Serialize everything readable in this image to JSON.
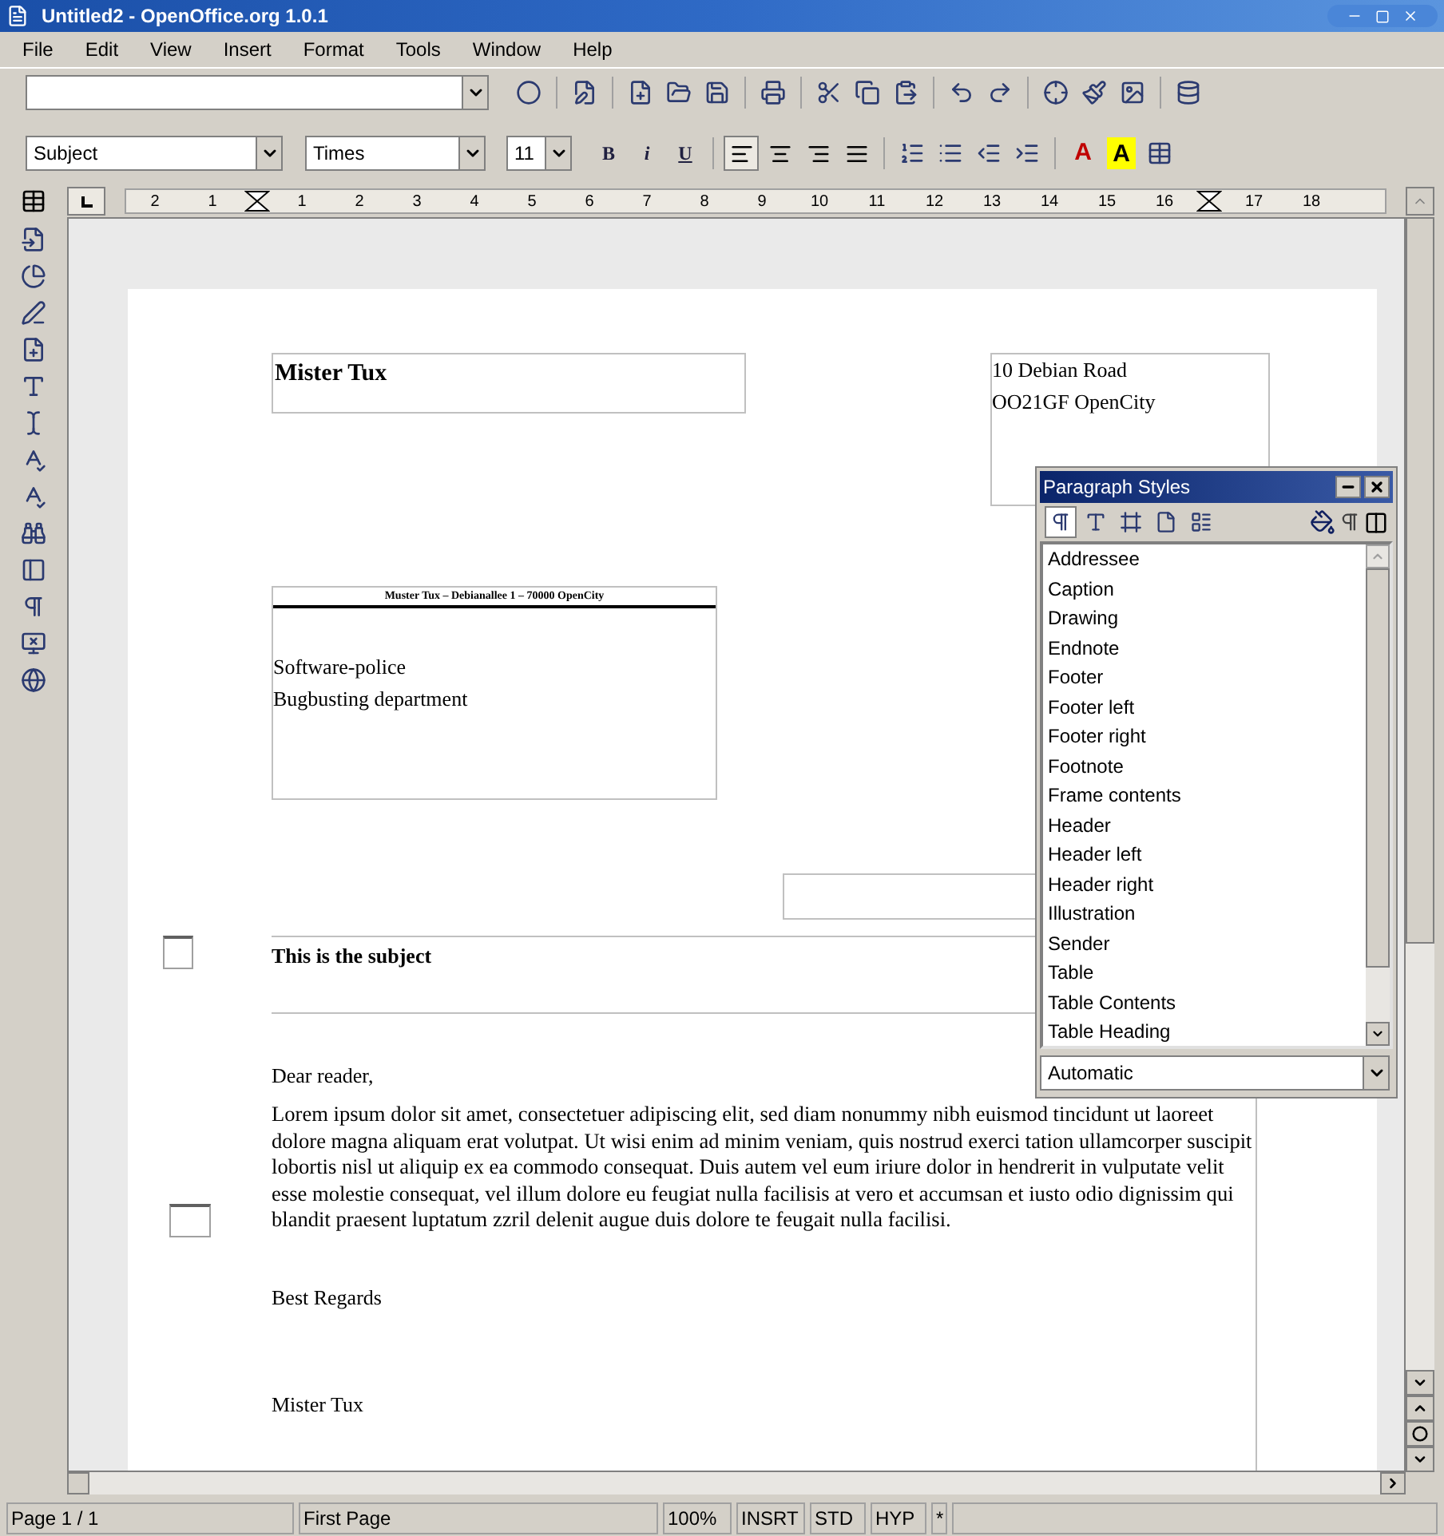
{
  "window": {
    "title": "Untitled2 - OpenOffice.org 1.0.1"
  },
  "menu": [
    {
      "label": "File"
    },
    {
      "label": "Edit"
    },
    {
      "label": "View"
    },
    {
      "label": "Insert"
    },
    {
      "label": "Format"
    },
    {
      "label": "Tools"
    },
    {
      "label": "Window"
    },
    {
      "label": "Help"
    }
  ],
  "formatting": {
    "style": "Subject",
    "font": "Times",
    "size": "11",
    "buttons": [
      {
        "kind": "bold",
        "label": "B",
        "on": false
      },
      {
        "kind": "italic",
        "label": "i",
        "on": false
      },
      {
        "kind": "underline",
        "label": "U",
        "on": false
      }
    ],
    "alignment": [
      {
        "selected": true
      },
      {
        "selected": false
      },
      {
        "selected": false
      },
      {
        "selected": false
      }
    ],
    "color_buttons": [
      {
        "label": "A",
        "color": "#c00000"
      },
      {
        "label": "A",
        "color": "#ffff00"
      }
    ]
  },
  "ruler": {
    "marks": [
      {
        "kind": "number",
        "label": "2"
      },
      {
        "kind": "number",
        "label": "1"
      },
      {
        "kind": "indent"
      },
      {
        "kind": "number",
        "label": "1"
      },
      {
        "kind": "number",
        "label": "2"
      },
      {
        "kind": "number",
        "label": "3"
      },
      {
        "kind": "number",
        "label": "4"
      },
      {
        "kind": "number",
        "label": "5"
      },
      {
        "kind": "number",
        "label": "6"
      },
      {
        "kind": "number",
        "label": "7"
      },
      {
        "kind": "number",
        "label": "8"
      },
      {
        "kind": "number",
        "label": "9"
      },
      {
        "kind": "number",
        "label": "10"
      },
      {
        "kind": "number",
        "label": "11"
      },
      {
        "kind": "number",
        "label": "12"
      },
      {
        "kind": "number",
        "label": "13"
      },
      {
        "kind": "number",
        "label": "14"
      },
      {
        "kind": "number",
        "label": "15"
      },
      {
        "kind": "number",
        "label": "16"
      },
      {
        "kind": "indent"
      },
      {
        "kind": "number",
        "label": "17"
      },
      {
        "kind": "number",
        "label": "18"
      }
    ]
  },
  "document": {
    "name": "Mister Tux",
    "address": [
      "10 Debian Road",
      "OO21GF OpenCity"
    ],
    "sender_line": "Muster Tux – Debianallee 1 – 70000 OpenCity",
    "recipient": [
      "Software-police",
      "Bugbusting department"
    ],
    "subject": "This is the subject",
    "greeting": "Dear reader,",
    "body": "Lorem ipsum dolor sit amet, consectetuer adipiscing elit, sed diam nonummy nibh euismod tincidunt ut laoreet dolore magna aliquam erat volutpat. Ut wisi enim ad minim veniam, quis nostrud exerci tation ullamcorper suscipit lobortis nisl ut aliquip ex ea commodo consequat. Duis autem vel eum iriure dolor in hendrerit in vulputate velit esse molestie consequat, vel illum dolore eu feugiat nulla facilisis at vero et accumsan et iusto odio dignissim qui blandit praesent luptatum zzril delenit augue duis dolore te feugait nulla facilisi.",
    "closing": "Best Regards",
    "signature": "Mister Tux"
  },
  "stylist": {
    "title": "Paragraph Styles",
    "families": [
      {
        "selected": true
      },
      {
        "selected": false
      },
      {
        "selected": false
      },
      {
        "selected": false
      },
      {
        "selected": false
      }
    ],
    "styles": [
      {
        "label": "Addressee",
        "selected": false
      },
      {
        "label": "Caption",
        "selected": false
      },
      {
        "label": "Drawing",
        "selected": false
      },
      {
        "label": "Endnote",
        "selected": false
      },
      {
        "label": "Footer",
        "selected": false
      },
      {
        "label": "Footer left",
        "selected": false
      },
      {
        "label": "Footer right",
        "selected": false
      },
      {
        "label": "Footnote",
        "selected": false
      },
      {
        "label": "Frame contents",
        "selected": false
      },
      {
        "label": "Header",
        "selected": false
      },
      {
        "label": "Header left",
        "selected": false
      },
      {
        "label": "Header right",
        "selected": false
      },
      {
        "label": "Illustration",
        "selected": false
      },
      {
        "label": "Sender",
        "selected": false
      },
      {
        "label": "Table",
        "selected": false
      },
      {
        "label": "Table Contents",
        "selected": false
      },
      {
        "label": "Table Heading",
        "selected": false
      }
    ],
    "filter": "Automatic"
  },
  "status_bar": [
    {
      "label": "Page 1 / 1"
    },
    {
      "label": "First Page"
    },
    {
      "label": "100%"
    },
    {
      "label": "INSRT"
    },
    {
      "label": "STD"
    },
    {
      "label": "HYP"
    },
    {
      "label": "*"
    }
  ]
}
